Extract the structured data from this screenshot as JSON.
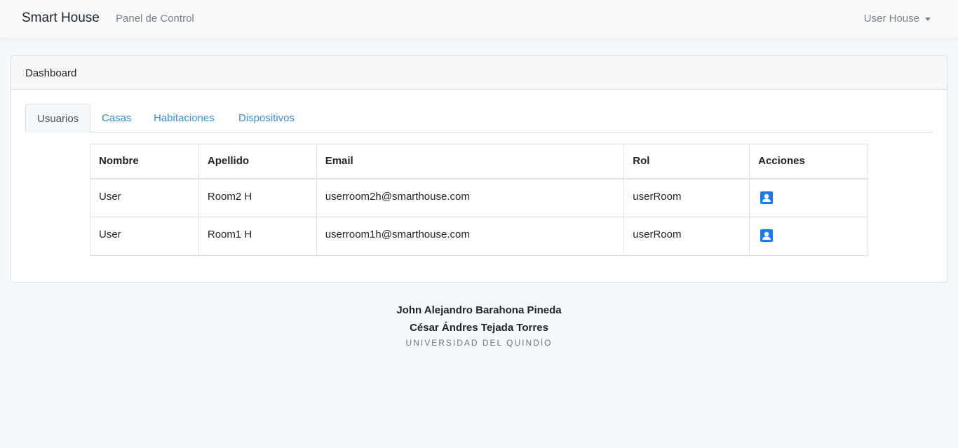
{
  "navbar": {
    "brand": "Smart House",
    "nav_link": "Panel de Control",
    "user_menu": "User House"
  },
  "card": {
    "header": "Dashboard",
    "tabs": [
      {
        "label": "Usuarios",
        "active": true
      },
      {
        "label": "Casas",
        "active": false
      },
      {
        "label": "Habitaciones",
        "active": false
      },
      {
        "label": "Dispositivos",
        "active": false
      }
    ],
    "table": {
      "headers": [
        "Nombre",
        "Apellido",
        "Email",
        "Rol",
        "Acciones"
      ],
      "rows": [
        {
          "nombre": "User",
          "apellido": "Room2 H",
          "email": "userroom2h@smarthouse.com",
          "rol": "userRoom",
          "action_icon": "contact-icon"
        },
        {
          "nombre": "User",
          "apellido": "Room1 H",
          "email": "userroom1h@smarthouse.com",
          "rol": "userRoom",
          "action_icon": "contact-icon"
        }
      ]
    }
  },
  "footer": {
    "authors": [
      "John Alejandro Barahona Pineda",
      "César Ándres Tejada Torres"
    ],
    "university": "UNIVERSIDAD DEL QUINDÍO"
  },
  "colors": {
    "accent": "#3490dc",
    "icon": "#1a7ce6",
    "background": "#f5f8fa"
  }
}
